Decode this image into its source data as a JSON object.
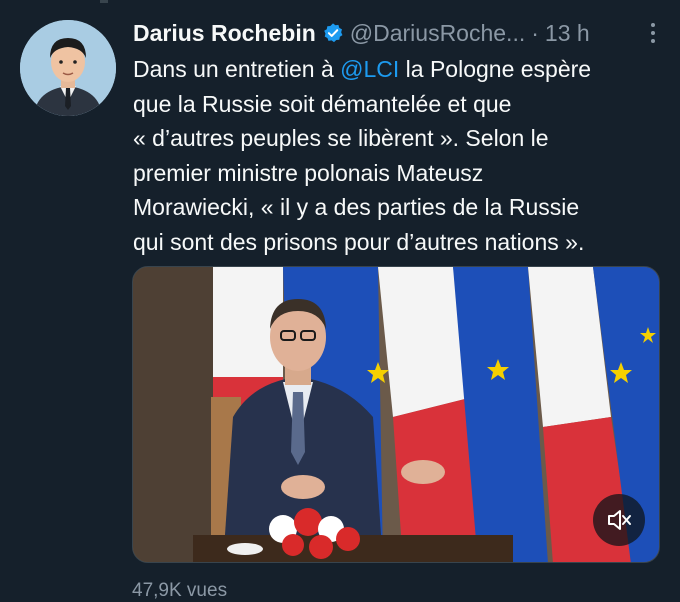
{
  "tweet": {
    "author_name": "Darius Rochebin",
    "handle": "@DariusRoche...",
    "separator": "·",
    "time": "13 h",
    "text": {
      "line1_before": "Dans un entretien à ",
      "mention": "@LCI",
      "line1_after": " la Pologne espère",
      "line2": "que la Russie soit démantelée et que",
      "line3": "« d’autres peuples se libèrent ». Selon le",
      "line4": "premier ministre polonais Mateusz",
      "line5": "Morawiecki, « il y a des parties de la Russie",
      "line6": "qui sont des prisons pour d’autres nations »."
    },
    "views": "47,9K vues"
  },
  "icons": {
    "verified": "verified-badge-icon",
    "more": "more-options-icon",
    "mute": "muted-speaker-icon"
  },
  "colors": {
    "background": "#15202b",
    "text": "#f7f9f9",
    "secondary": "#8b98a5",
    "accent": "#1d9bf0"
  }
}
